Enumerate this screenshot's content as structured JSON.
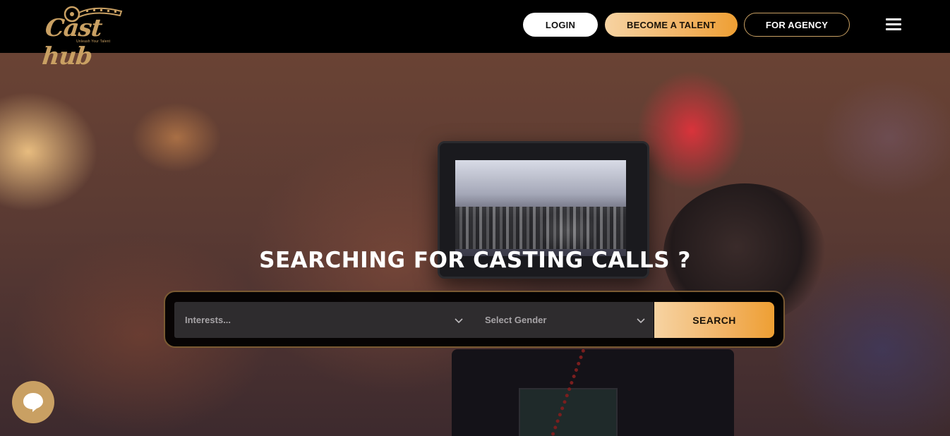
{
  "header": {
    "logo_text": "Cast hub",
    "logo_tagline": "Unleash Your Talent",
    "login_label": "LOGIN",
    "become_talent_label": "BECOME A TALENT",
    "for_agency_label": "FOR AGENCY",
    "menu_icon": "hamburger-menu-icon"
  },
  "hero": {
    "title": "SEARCHING FOR CASTING CALLS ?",
    "search": {
      "interests_placeholder": "Interests...",
      "gender_placeholder": "Select Gender",
      "search_label": "SEARCH"
    }
  },
  "chat": {
    "icon": "chat-bubble-icon"
  },
  "colors": {
    "header_bg": "#000000",
    "accent_gold": "#c9a063",
    "button_gradient_start": "#f6d3a2",
    "button_gradient_end": "#ee9f33",
    "title_text": "#ffffff"
  }
}
